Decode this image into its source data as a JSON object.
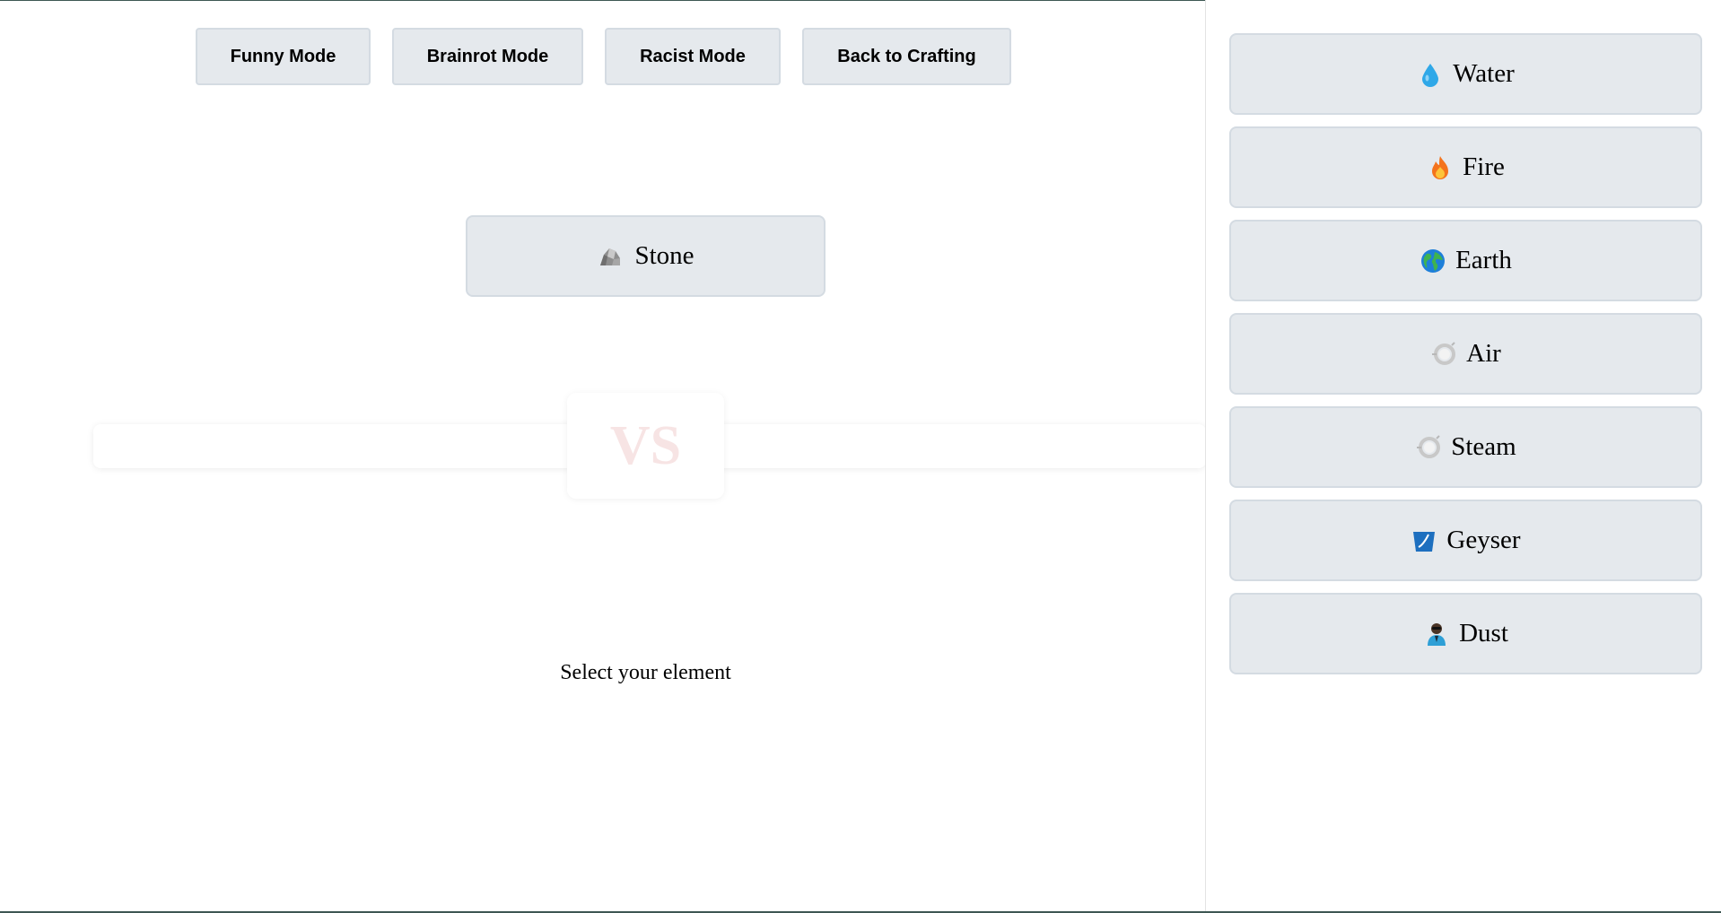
{
  "toolbar": {
    "buttons": [
      {
        "label": "Funny Mode"
      },
      {
        "label": "Brainrot Mode"
      },
      {
        "label": "Racist Mode"
      },
      {
        "label": "Back to Crafting"
      }
    ]
  },
  "battle": {
    "selected": {
      "name": "Stone",
      "icon": "rock-icon"
    },
    "vs_label": "VS",
    "prompt": "Select your element"
  },
  "sidebar": {
    "elements": [
      {
        "name": "Water",
        "icon": "water-drop-icon"
      },
      {
        "name": "Fire",
        "icon": "fire-icon"
      },
      {
        "name": "Earth",
        "icon": "globe-icon"
      },
      {
        "name": "Air",
        "icon": "wind-ring-icon"
      },
      {
        "name": "Steam",
        "icon": "wind-ring-icon"
      },
      {
        "name": "Geyser",
        "icon": "water-bucket-icon"
      },
      {
        "name": "Dust",
        "icon": "person-icon"
      }
    ]
  },
  "colors": {
    "button_bg": "#e5e9ed",
    "button_border": "#d4dbe2",
    "vs_text": "#f7e4e4",
    "frame_line": "#3d5753"
  }
}
